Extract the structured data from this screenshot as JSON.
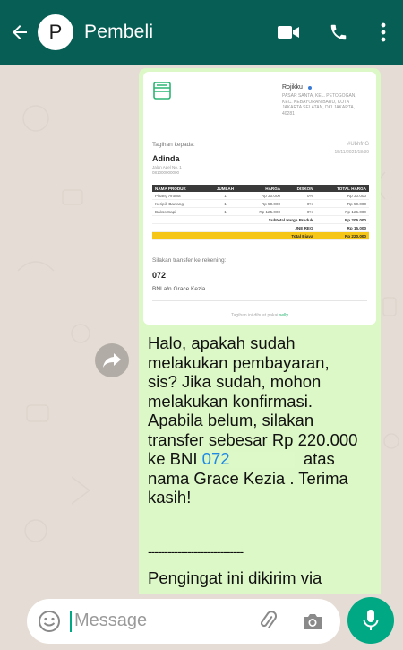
{
  "header": {
    "avatar_letter": "P",
    "contact_name": "Pembeli"
  },
  "invoice": {
    "store_name": "Rojikku",
    "store_address": "PASAR SANTA, KEL. PETOGOGAN, KEC. KEBAYORAN BARU, KOTA JAKARTA SELATAN, DKI JAKARTA, 40281",
    "bill_to_label": "Tagihan kepada:",
    "invoice_no": "#UbhfnG",
    "date": "15/11/2021/18:39",
    "customer_name": "Adinda",
    "customer_address": "Jalan Apel No. 1",
    "customer_phone": "081000000000",
    "columns": [
      "NAMA PRODUK",
      "JUMLAH",
      "HARGA",
      "DISKON",
      "TOTAL HARGA"
    ],
    "rows": [
      {
        "name": "Pisang Aroma",
        "qty": "1",
        "price": "Rp 30.000",
        "disc": "0%",
        "total": "Rp 30.000"
      },
      {
        "name": "Keripik Bawang",
        "qty": "1",
        "price": "Rp 50.000",
        "disc": "0%",
        "total": "Rp 50.000"
      },
      {
        "name": "Bakso Sapi",
        "qty": "1",
        "price": "Rp 125.000",
        "disc": "0%",
        "total": "Rp 125.000"
      }
    ],
    "subtotal_label": "Subtotal Harga Produk",
    "subtotal_value": "Rp 205.000",
    "shipping_label": "JNE REG",
    "shipping_value": "Rp 15.000",
    "total_label": "Total Biaya",
    "total_value": "Rp 220.000",
    "transfer_label": "Silakan transfer ke rekening:",
    "account_number": "072",
    "bank_holder": "BNI a/n Grace Kezia",
    "footer": "Tagihan ini dibuat pakai",
    "footer_brand": "selly"
  },
  "message": {
    "lines": [
      "Halo, apakah sudah",
      "melakukan pembayaran,",
      "sis? Jika sudah, mohon",
      "melakukan konfirmasi.",
      "Apabila belum, silakan",
      "transfer sebesar Rp 220.000"
    ],
    "bank_prefix": "ke BNI ",
    "account_number": "072",
    "after_account": "atas",
    "last_lines": [
      "nama Grace Kezia . Terima",
      "kasih!"
    ],
    "divider": "-----------------------------",
    "reminder": "Pengingat ini dikirim via"
  },
  "composer": {
    "placeholder": "Message"
  },
  "colors": {
    "header": "#075e54",
    "accent": "#00a884",
    "bubble": "#dcf8c6"
  }
}
